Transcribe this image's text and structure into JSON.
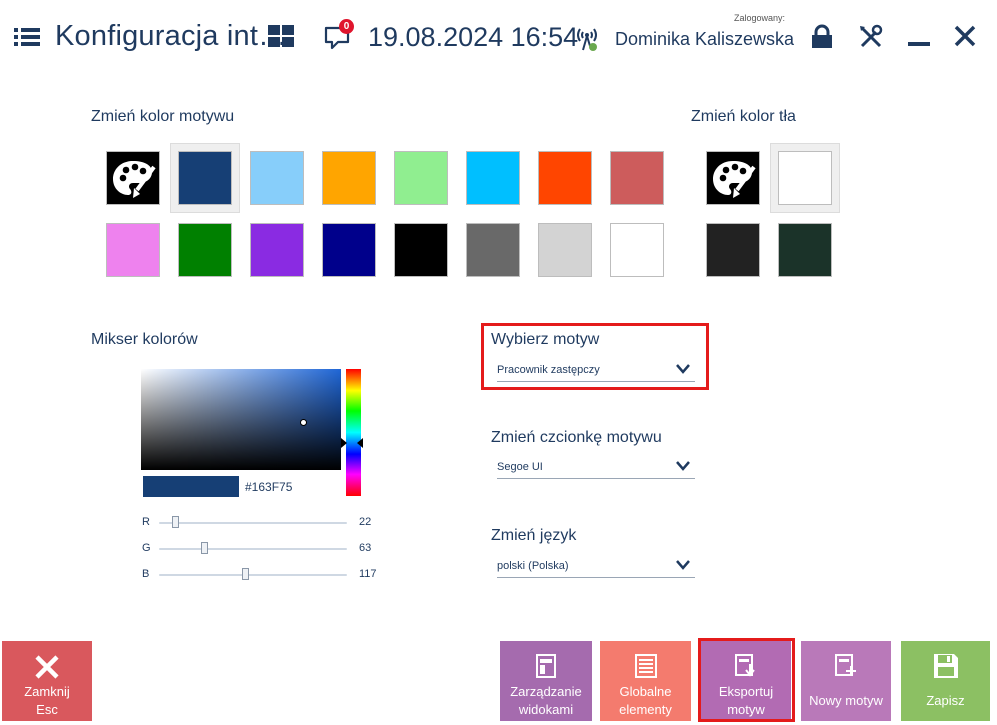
{
  "header": {
    "title": "Konfiguracja int…",
    "datetime": "19.08.2024 16:54",
    "logged_label": "Zalogowany:",
    "user": "Dominika Kaliszewska",
    "notifications_count": "0"
  },
  "theme_color": {
    "label": "Zmień kolor motywu",
    "selected_index": 1,
    "swatches": [
      "palette",
      "#163F75",
      "#87CEFA",
      "#FFA500",
      "#90EE90",
      "#00BFFF",
      "#FF4500",
      "#CD5C5C",
      "#EE82EE",
      "#008000",
      "#8A2BE2",
      "#00008B",
      "#000000",
      "#696969",
      "#D3D3D3",
      "#FFFFFF"
    ]
  },
  "bg_color": {
    "label": "Zmień kolor tła",
    "selected_index": 1,
    "swatches": [
      "palette",
      "#FFFFFF",
      "#222222",
      "#1B3329"
    ]
  },
  "mixer": {
    "label": "Mikser kolorów",
    "hex": "#163F75",
    "hex_display": "#163F75",
    "r_label": "R",
    "r": "22",
    "g_label": "G",
    "g": "63",
    "b_label": "B",
    "b": "117"
  },
  "theme": {
    "label": "Wybierz motyw",
    "value": "Pracownik zastępczy"
  },
  "font": {
    "label": "Zmień czcionkę motywu",
    "value": "Segoe UI"
  },
  "language": {
    "label": "Zmień język",
    "value": "polski (Polska)"
  },
  "buttons": {
    "close_line1": "Zamknij",
    "close_line2": "Esc",
    "views_line1": "Zarządzanie",
    "views_line2": "widokami",
    "global_line1": "Globalne",
    "global_line2": "elementy",
    "export_line1": "Eksportuj",
    "export_line2": "motyw",
    "new_theme": "Nowy motyw",
    "save": "Zapisz"
  },
  "colors": {
    "accent": "#1F3A5F",
    "highlight": "#E41B1B",
    "close_btn": "#D9585D",
    "views_btn": "#A56BAE",
    "global_btn": "#F47B6E",
    "export_btn": "#B26BB3",
    "new_btn": "#B979B9",
    "save_btn": "#8CC063"
  }
}
